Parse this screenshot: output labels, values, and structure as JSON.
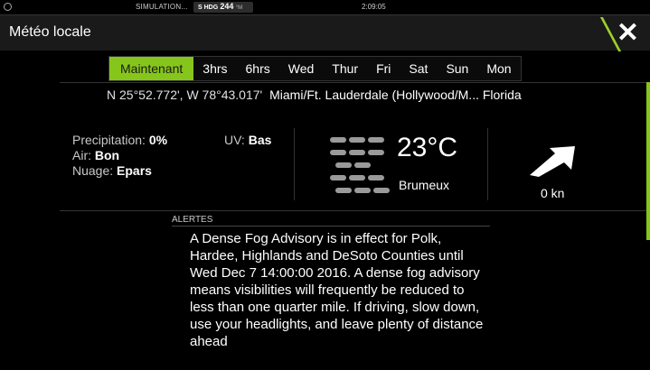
{
  "statusbar": {
    "simulation": "SIMULATION...",
    "hdg_label": "S HDG",
    "hdg_value": "244",
    "hdg_unit": "°M",
    "time": "2:09:05"
  },
  "titlebar": {
    "title": "Météo locale",
    "close_glyph": "✕"
  },
  "tabs": [
    {
      "label": "Maintenant",
      "active": true
    },
    {
      "label": "3hrs"
    },
    {
      "label": "6hrs"
    },
    {
      "label": "Wed"
    },
    {
      "label": "Thur"
    },
    {
      "label": "Fri"
    },
    {
      "label": "Sat"
    },
    {
      "label": "Sun"
    },
    {
      "label": "Mon"
    }
  ],
  "location": {
    "coords": "N  25°52.772', W  78°43.017'",
    "name": "Miami/Ft. Lauderdale (Hollywood/M... Florida"
  },
  "conditions": {
    "precip_label": "Precipitation:",
    "precip_value": "0%",
    "air_label": "Air:",
    "air_value": "Bon",
    "cloud_label": "Nuage:",
    "cloud_value": "Epars",
    "uv_label": "UV:",
    "uv_value": "Bas",
    "temperature": "23°C",
    "condition": "Brumeux",
    "wind": "0 kn",
    "icon": "fog-icon"
  },
  "alerts": {
    "header": "ALERTES",
    "text": "A Dense Fog Advisory is in effect for Polk, Hardee, Highlands and DeSoto Counties until Wed Dec 7 14:00:00 2016. A dense fog advisory means visibilities will frequently be reduced to less than one quarter mile. If driving, slow down, use your headlights, and leave plenty of distance ahead"
  },
  "colors": {
    "accent": "#86c61a",
    "background": "#000000",
    "title_bar": "#1a1a1a"
  }
}
